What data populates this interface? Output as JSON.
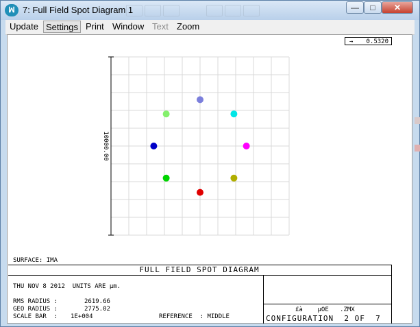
{
  "window": {
    "app_icon": "zemax-logo-icon",
    "title": "7: Full Field Spot Diagram 1",
    "controls": {
      "minimize": "—",
      "maximize": "□",
      "close": "✕"
    }
  },
  "menu": [
    {
      "label": "Update"
    },
    {
      "label": "Settings"
    },
    {
      "label": "Print"
    },
    {
      "label": "Window"
    },
    {
      "label": "Text"
    },
    {
      "label": "Zoom"
    }
  ],
  "scale": "0.5320",
  "plot": {
    "scale_label": "10000.00",
    "spots": [
      {
        "x": 0,
        "y": 2.6,
        "color": "#7b7fdc"
      },
      {
        "x": 1.9,
        "y": 1.8,
        "color": "#00e6e6"
      },
      {
        "x": 2.6,
        "y": 0,
        "color": "#ff00ff"
      },
      {
        "x": 1.9,
        "y": -1.8,
        "color": "#b0ae00"
      },
      {
        "x": 0,
        "y": -2.6,
        "color": "#e00000"
      },
      {
        "x": -1.9,
        "y": -1.8,
        "color": "#00d400"
      },
      {
        "x": -2.6,
        "y": 0,
        "color": "#0000c8"
      },
      {
        "x": -1.9,
        "y": 1.8,
        "color": "#84f06c"
      }
    ]
  },
  "surface": "SURFACE: IMA",
  "diagram_title": "FULL FIELD SPOT DIAGRAM",
  "info": {
    "date_units": "THU NOV 8 2012  UNITS ARE µm.",
    "rms_label": "RMS RADIUS :",
    "rms_value": "2619.66",
    "geo_label": "GEO RADIUS :",
    "geo_value": "2775.02",
    "scale_label": "SCALE BAR  :",
    "scale_value": "1E+004",
    "reference": "REFERENCE  : MIDDLE"
  },
  "file_info": {
    "line1": "£à    µOE   .ZMX",
    "configuration": "CONFIGURATION  2 OF  7"
  }
}
